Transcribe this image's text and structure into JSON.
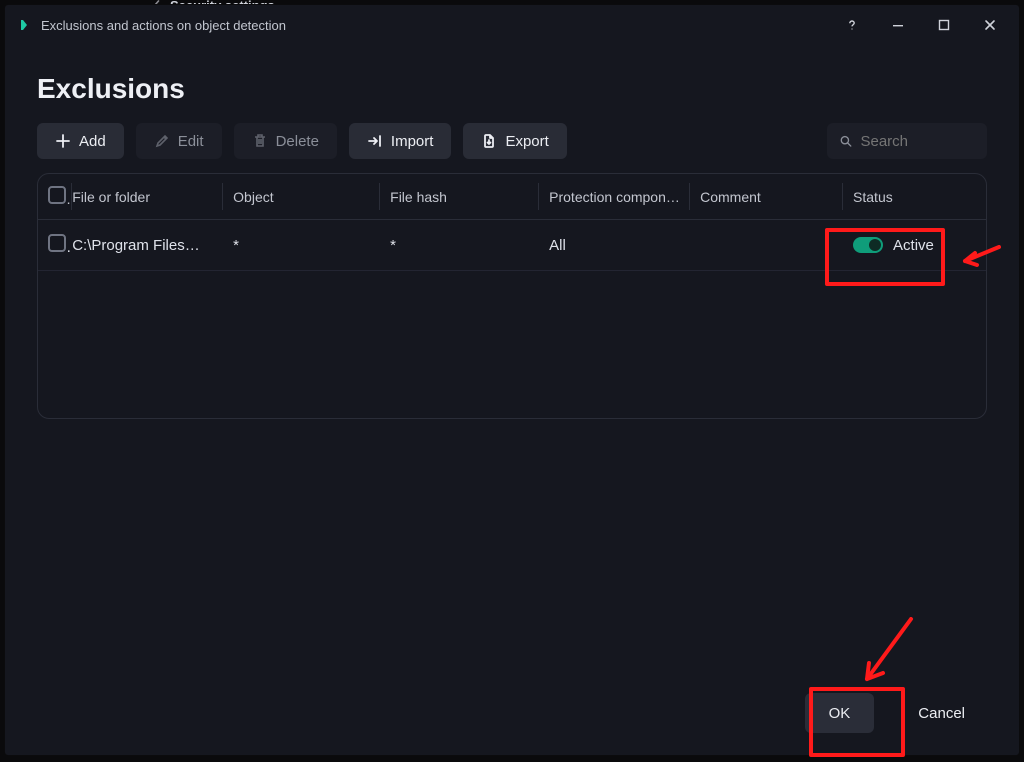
{
  "background": {
    "parent_tab_label": "Security settings"
  },
  "window": {
    "title": "Exclusions and actions on object detection"
  },
  "page": {
    "heading": "Exclusions"
  },
  "toolbar": {
    "add_label": "Add",
    "edit_label": "Edit",
    "delete_label": "Delete",
    "import_label": "Import",
    "export_label": "Export"
  },
  "search": {
    "placeholder": "Search"
  },
  "table": {
    "headers": {
      "file": "File or folder",
      "object": "Object",
      "hash": "File hash",
      "protection": "Protection compone…",
      "comment": "Comment",
      "status": "Status"
    },
    "rows": [
      {
        "file": "C:\\Program Files…",
        "object": "*",
        "hash": "*",
        "protection": "All",
        "comment": "",
        "status_label": "Active",
        "status_on": true
      }
    ]
  },
  "footer": {
    "ok_label": "OK",
    "cancel_label": "Cancel"
  }
}
